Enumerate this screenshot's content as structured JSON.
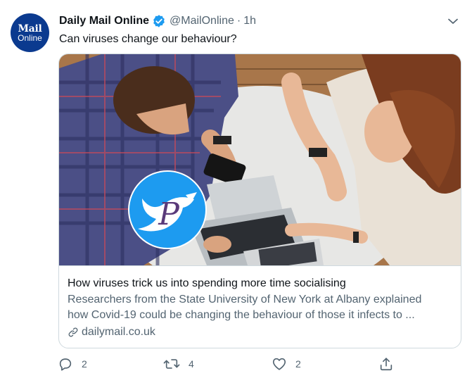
{
  "account": {
    "avatar_line1": "Mail",
    "avatar_line2": "Online",
    "name": "Daily Mail Online",
    "handle": "@MailOnline",
    "separator": "·",
    "time": "1h"
  },
  "tweet": {
    "text": "Can viruses change our behaviour?"
  },
  "card": {
    "title": "How viruses trick us into spending more time socialising",
    "description_line1": "Researchers from the State University of New York at Albany explained",
    "description_line2": "how Covid-19 could be changing the behaviour of those it infects to ...",
    "domain": "dailymail.co.uk",
    "overlay_letter": "P"
  },
  "actions": {
    "reply_count": "2",
    "retweet_count": "4",
    "like_count": "2"
  },
  "colors": {
    "twitter_blue": "#1d9bf0",
    "secondary_text": "#536471",
    "avatar_bg": "#0b3a8f"
  }
}
